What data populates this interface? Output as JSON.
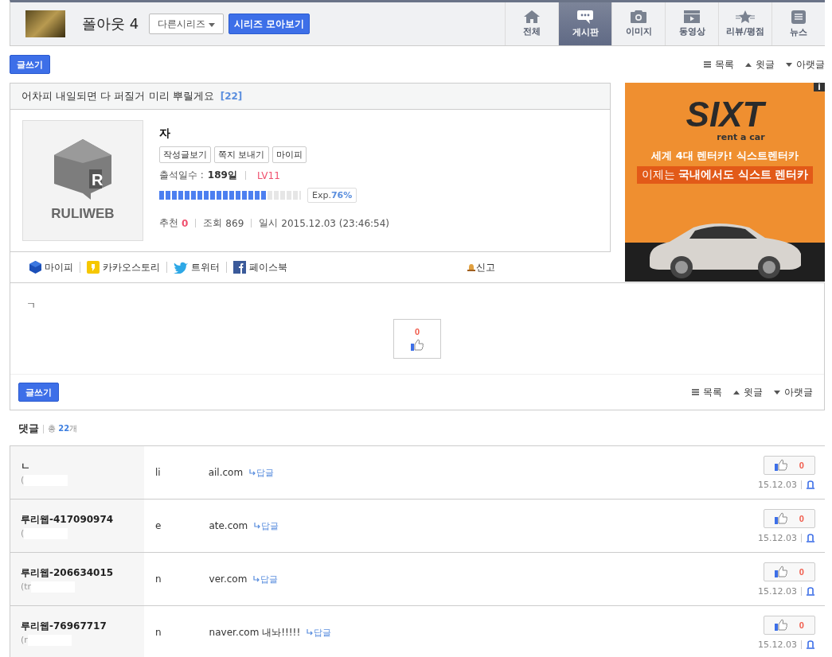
{
  "header": {
    "title": "폴아웃 4",
    "series_dropdown": "다른시리즈",
    "series_button": "시리즈 모아보기"
  },
  "nav": [
    {
      "label": "전체",
      "kind": "home",
      "selected": false
    },
    {
      "label": "게시판",
      "kind": "chat",
      "selected": true
    },
    {
      "label": "이미지",
      "kind": "camera",
      "selected": false
    },
    {
      "label": "동영상",
      "kind": "video",
      "selected": false
    },
    {
      "label": "리뷰/평점",
      "kind": "star",
      "selected": false
    },
    {
      "label": "뉴스",
      "kind": "news",
      "selected": false
    }
  ],
  "write_button": "글쓰기",
  "post_links": [
    {
      "kind": "list",
      "label": "목록"
    },
    {
      "kind": "up",
      "label": "윗글"
    },
    {
      "kind": "down",
      "label": "아랫글"
    }
  ],
  "bottom_write_button": "글쓰기",
  "bottom_links": [
    {
      "kind": "list",
      "label": "목록"
    },
    {
      "kind": "up",
      "label": "윗글"
    },
    {
      "kind": "down",
      "label": "아랫글"
    }
  ],
  "post": {
    "title": "어차피 내일되면 다 퍼질거 미리 뿌릴게요",
    "comment_count": "[22]",
    "author": "자",
    "author_buttons": [
      "작성글보기",
      "쪽지 보내기",
      "마이피"
    ],
    "logo_text": "RULIWEB",
    "logo_mark": "R",
    "attendance_label": "출석일수 :",
    "attendance_value": "189일",
    "level_label": "LV11",
    "exp": {
      "level": 0.76,
      "label": "Exp.",
      "value": "76%"
    },
    "stats": [
      {
        "label": "추천",
        "value": "0",
        "kind": "accent"
      },
      {
        "label": "조회",
        "value": "869",
        "kind": "plain"
      },
      {
        "label": "일시",
        "value": "2015.12.03 (23:46:54)",
        "kind": "plain"
      }
    ],
    "share": [
      {
        "kind": "mypi",
        "label": "마이피"
      },
      {
        "kind": "kakao",
        "label": "카카오스토리"
      },
      {
        "kind": "twitter",
        "label": "트위터"
      },
      {
        "kind": "facebook",
        "label": "페이스북"
      }
    ],
    "report": "신고",
    "body": "ㄱ",
    "like_count": "0"
  },
  "ad": {
    "brand": "SIXT",
    "tagline": "rent a car",
    "line1": "세계 4대 렌터카! 식스트렌터카",
    "line2": "이제는 **국내에서도 식스트 렌터카**",
    "info": "i"
  },
  "comments_header": {
    "title": "댓글",
    "total_label": "총",
    "total": "22",
    "unit": "개"
  },
  "comments": [
    {
      "name": "ㄴ",
      "sub": "(",
      "body_start": "li",
      "body_end": "ail.com",
      "reply": "답글",
      "likes": "0",
      "date": "15.12.03"
    },
    {
      "name": "루리웹-417090974",
      "sub": "(",
      "body_start": "e",
      "body_end": "ate.com",
      "reply": "답글",
      "likes": "0",
      "date": "15.12.03"
    },
    {
      "name": "루리웹-206634015",
      "sub": "(tr",
      "body_start": "n",
      "body_end": "ver.com",
      "reply": "답글",
      "likes": "0",
      "date": "15.12.03"
    },
    {
      "name": "루리웹-76967717",
      "sub": "(r",
      "body_start": "n",
      "body_end": "naver.com 내놔!!!!!",
      "reply": "답글",
      "likes": "0",
      "date": "15.12.03"
    }
  ]
}
